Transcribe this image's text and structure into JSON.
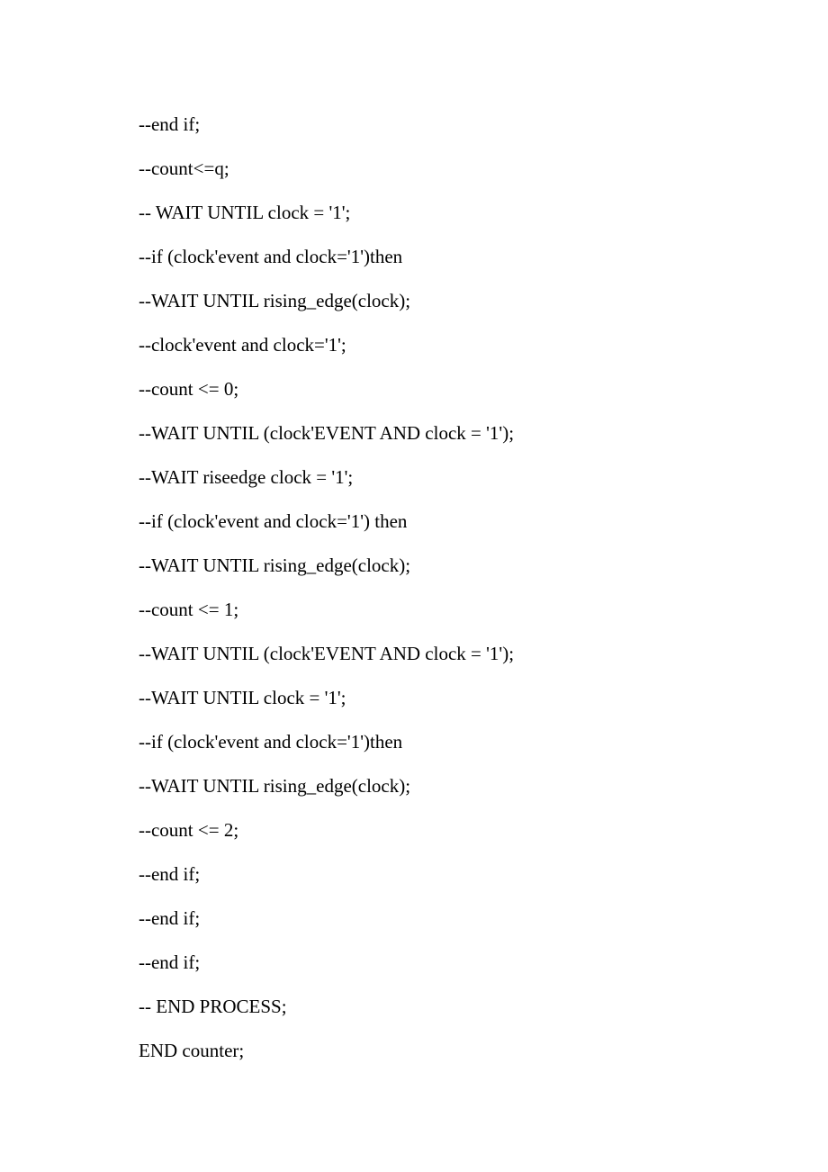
{
  "lines": [
    "--end if;",
    "--count<=q;",
    "-- WAIT UNTIL clock = '1';",
    "--if (clock'event and clock='1')then",
    "--WAIT UNTIL rising_edge(clock);",
    "--clock'event and clock='1';",
    "--count <= 0;",
    "--WAIT UNTIL (clock'EVENT AND clock = '1');",
    "--WAIT riseedge clock = '1';",
    "--if (clock'event and clock='1') then",
    "--WAIT UNTIL rising_edge(clock);",
    "--count <= 1;",
    "--WAIT UNTIL (clock'EVENT AND clock = '1');",
    "--WAIT UNTIL clock = '1';",
    "--if (clock'event and clock='1')then",
    "--WAIT UNTIL rising_edge(clock);",
    "--count <= 2;",
    "--end if;",
    "--end if;",
    "--end if;",
    "-- END PROCESS;",
    "END counter;"
  ]
}
